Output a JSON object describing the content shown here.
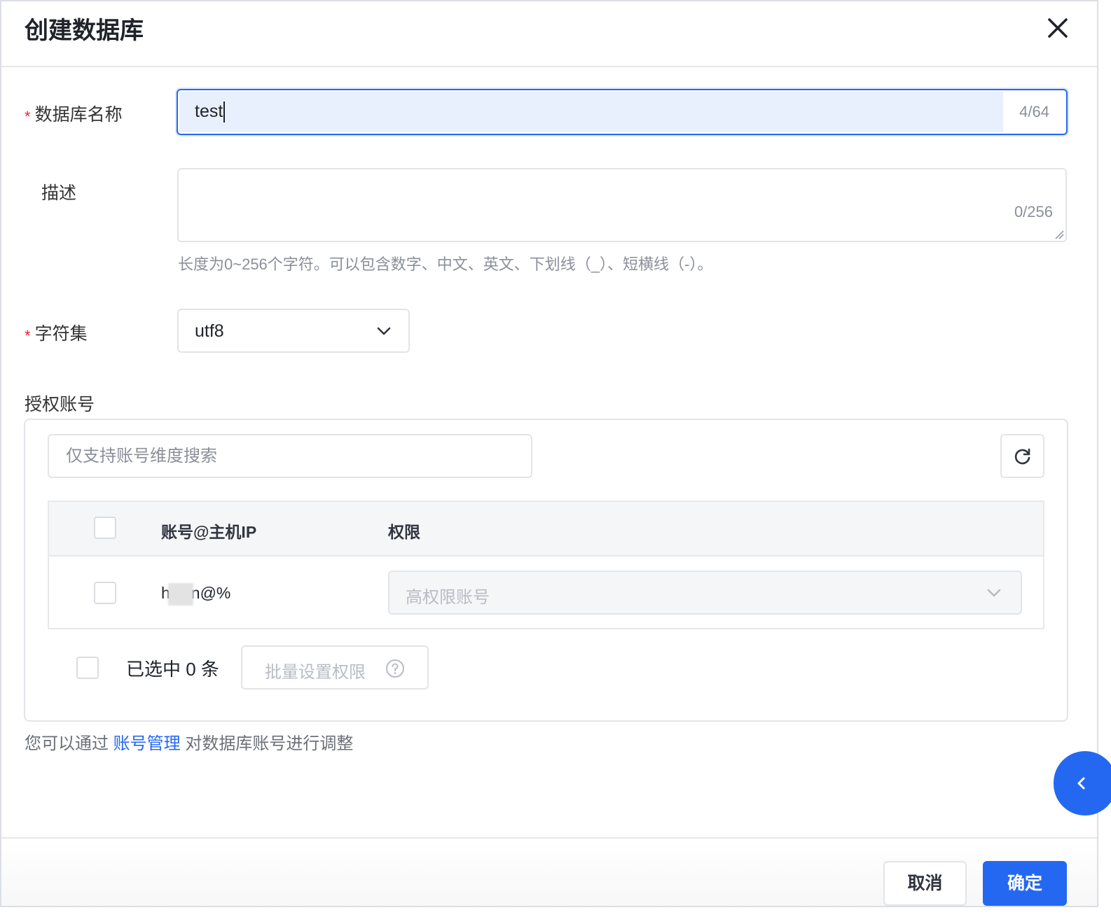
{
  "dialog": {
    "title": "创建数据库"
  },
  "form": {
    "name_label": "数据库名称",
    "required_mark": "*",
    "name_value": "test",
    "name_count": "4/64",
    "desc_label": "描述",
    "desc_value": "",
    "desc_count": "0/256",
    "desc_hint": "长度为0~256个字符。可以包含数字、中文、英文、下划线（_）、短横线（-）。",
    "charset_label": "字符集",
    "charset_value": "utf8"
  },
  "auth": {
    "section_title": "授权账号",
    "search_placeholder": "仅支持账号维度搜索",
    "columns": {
      "account": "账号@主机IP",
      "permission": "权限"
    },
    "rows": [
      {
        "account_prefix": "h",
        "account_suffix": "n@%",
        "permission_placeholder": "高权限账号"
      }
    ],
    "selected_text": "已选中 0 条",
    "batch_button": "批量设置权限"
  },
  "manage_hint": {
    "before": "您可以通过 ",
    "link": "账号管理",
    "after": " 对数据库账号进行调整"
  },
  "footer": {
    "cancel_label": "取消",
    "ok_label": "确定"
  },
  "colors": {
    "primary": "#2468f2",
    "required": "#f5222d",
    "input_highlight": "#e8f0fe"
  },
  "icons": [
    "close-icon",
    "chevron-down-icon",
    "refresh-icon",
    "help-circle-icon",
    "chevron-left-icon",
    "resize-grip-icon"
  ]
}
